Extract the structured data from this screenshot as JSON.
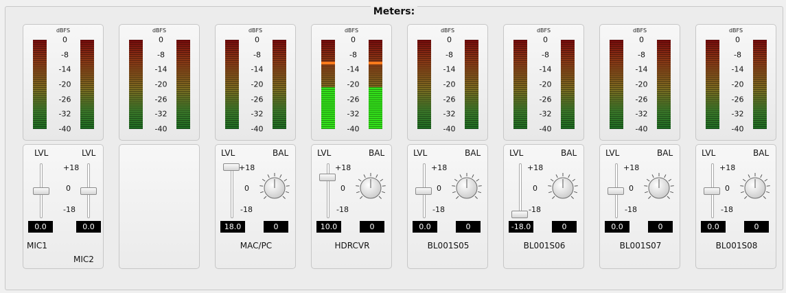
{
  "title": "Meters:",
  "dbfs_label": "dBFS",
  "scale": [
    "0",
    "-8",
    "-14",
    "-20",
    "-26",
    "-32",
    "-40"
  ],
  "labels": {
    "lvl": "LVL",
    "bal": "BAL",
    "plus18": "+18",
    "zero": "0",
    "minus18": "-18"
  },
  "colors": {
    "peak": "#ff7a1c",
    "signal": "#33e01a"
  },
  "strips": [
    {
      "name": "MIC1",
      "name2": "MIC2",
      "type": "dual",
      "lvl_values": [
        "0.0",
        "0.0"
      ],
      "level_fraction": 0.5
    },
    {
      "type": "empty"
    },
    {
      "name": "MAC/PC",
      "type": "lvlbal",
      "lvl_value": "18.0",
      "bal_value": "0",
      "level_fraction": 1.0,
      "signal_fraction": 0
    },
    {
      "name": "HDRCVR",
      "type": "lvlbal",
      "lvl_value": "10.0",
      "bal_value": "0",
      "level_fraction": 0.78,
      "signal_fraction": 0.47,
      "peak_fraction": 0.72
    },
    {
      "name": "BL001S05",
      "type": "lvlbal",
      "lvl_value": "0.0",
      "bal_value": "0",
      "level_fraction": 0.5,
      "signal_fraction": 0
    },
    {
      "name": "BL001S06",
      "type": "lvlbal",
      "lvl_value": "-18.0",
      "bal_value": "0",
      "level_fraction": 0.0,
      "signal_fraction": 0
    },
    {
      "name": "BL001S07",
      "type": "lvlbal",
      "lvl_value": "0.0",
      "bal_value": "0",
      "level_fraction": 0.5,
      "signal_fraction": 0
    },
    {
      "name": "BL001S08",
      "type": "lvlbal",
      "lvl_value": "0.0",
      "bal_value": "0",
      "level_fraction": 0.5,
      "signal_fraction": 0
    }
  ]
}
